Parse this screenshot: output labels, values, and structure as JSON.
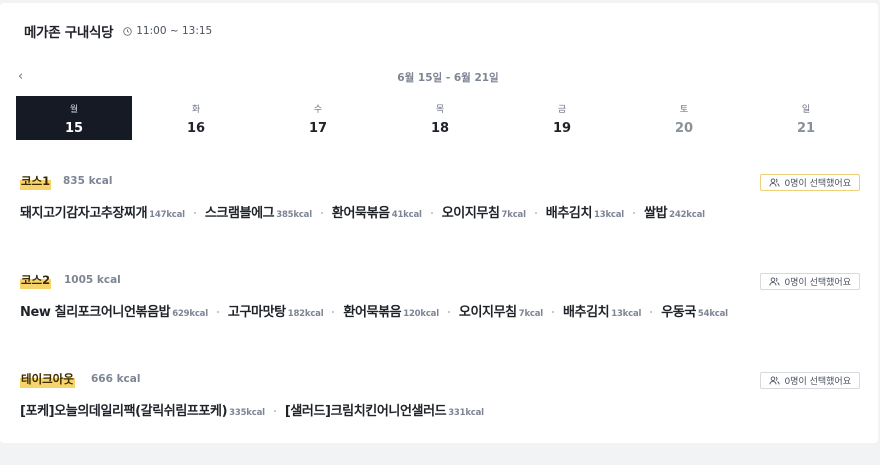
{
  "header": {
    "title": "메가존 구내식당",
    "hours": "11:00 ~ 13:15"
  },
  "week": {
    "prev": "‹",
    "range": "6월 15일 - 6월 21일",
    "days": [
      {
        "dow": "월",
        "num": "15",
        "selected": true
      },
      {
        "dow": "화",
        "num": "16"
      },
      {
        "dow": "수",
        "num": "17"
      },
      {
        "dow": "목",
        "num": "18"
      },
      {
        "dow": "금",
        "num": "19"
      },
      {
        "dow": "토",
        "num": "20",
        "weekend": true
      },
      {
        "dow": "일",
        "num": "21",
        "weekend": true
      }
    ]
  },
  "courses": [
    {
      "name": "코스1",
      "kcal": "835 kcal",
      "selected_text": "0명이 선택했어요",
      "dishes": [
        {
          "name": "돼지고기감자고추장찌개",
          "kcal": "147kcal"
        },
        {
          "name": "스크램블에그",
          "kcal": "385kcal"
        },
        {
          "name": "환어묵볶음",
          "kcal": "41kcal"
        },
        {
          "name": "오이지무침",
          "kcal": "7kcal"
        },
        {
          "name": "배추김치",
          "kcal": "13kcal"
        },
        {
          "name": "쌀밥",
          "kcal": "242kcal"
        }
      ]
    },
    {
      "name": "코스2",
      "kcal": "1005 kcal",
      "selected_text": "0명이 선택했어요",
      "dishes": [
        {
          "name": "New 칠리포크어니언볶음밥",
          "kcal": "629kcal"
        },
        {
          "name": "고구마맛탕",
          "kcal": "182kcal"
        },
        {
          "name": "환어묵볶음",
          "kcal": "120kcal"
        },
        {
          "name": "오이지무침",
          "kcal": "7kcal"
        },
        {
          "name": "배추김치",
          "kcal": "13kcal"
        },
        {
          "name": "우동국",
          "kcal": "54kcal"
        }
      ]
    },
    {
      "name": "테이크아웃",
      "kcal": "666 kcal",
      "selected_text": "0명이 선택했어요",
      "dishes": [
        {
          "name": "[포케]오늘의데일리팩(갈릭쉬림프포케)",
          "kcal": "335kcal"
        },
        {
          "name": "[샐러드]크림치킨어니언샐러드",
          "kcal": "331kcal"
        }
      ]
    }
  ]
}
